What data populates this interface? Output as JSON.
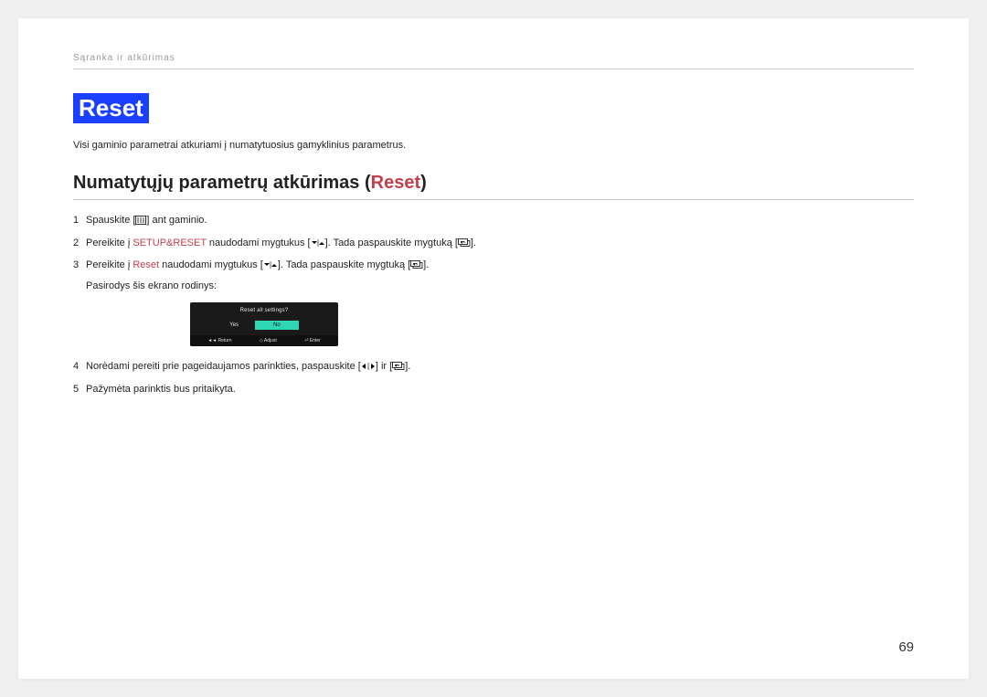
{
  "header": "Sąranka ir atkūrimas",
  "title": "Reset",
  "intro": "Visi gaminio parametrai atkuriami į numatytuosius gamyklinius parametrus.",
  "h2_prefix": "Numatytųjų parametrų atkūrimas (",
  "h2_accent": "Reset",
  "h2_suffix": ")",
  "steps": {
    "s1_num": "1",
    "s1_a": "Spauskite [",
    "s1_b": "] ant gaminio.",
    "s2_num": "2",
    "s2_a": "Pereikite į ",
    "s2_accent": "SETUP&RESET",
    "s2_b": " naudodami mygtukus [",
    "s2_c": "]. Tada paspauskite mygtuką [",
    "s2_d": "].",
    "s3_num": "3",
    "s3_a": "Pereikite į ",
    "s3_accent": "Reset",
    "s3_b": " naudodami mygtukus [",
    "s3_c": "]. Tada paspauskite mygtuką [",
    "s3_d": "].",
    "s3_sub": "Pasirodys šis ekrano rodinys:",
    "s4_num": "4",
    "s4_a": "Norėdami pereiti prie pageidaujamos parinkties, paspauskite [",
    "s4_b": "] ir [",
    "s4_c": "].",
    "s5_num": "5",
    "s5_a": "Pažymėta parinktis bus pritaikyta."
  },
  "mini": {
    "title": "Reset all settings?",
    "yes": "Yes",
    "no": "No",
    "return": "Return",
    "adjust": "Adjust",
    "enter": "Enter"
  },
  "page_number": "69"
}
